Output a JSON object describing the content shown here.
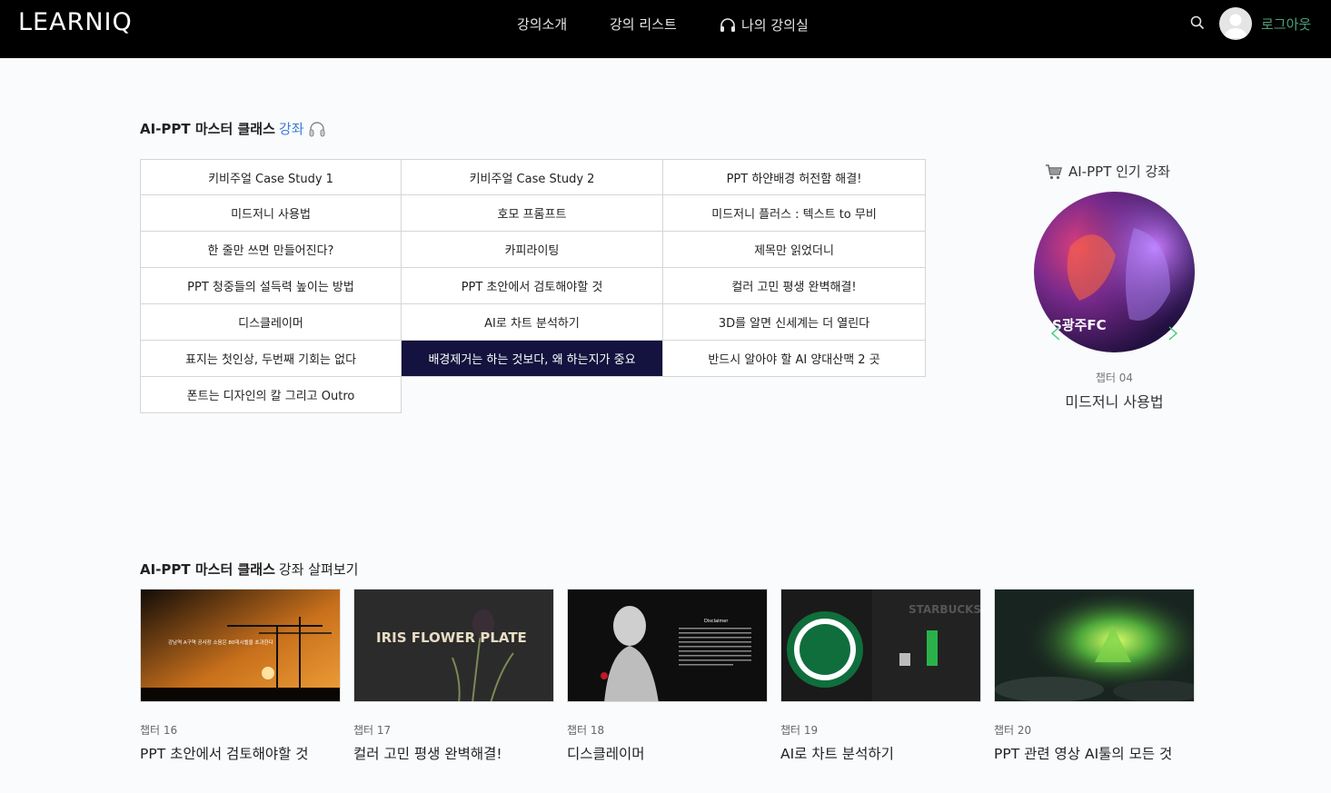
{
  "header": {
    "logo": "LEARNIQ",
    "nav": [
      "강의소개",
      "강의 리스트",
      "나의 강의실"
    ],
    "logout": "로그아웃"
  },
  "course": {
    "title_strong": "AI-PPT 마스터 클래스",
    "title_accent": "강좌",
    "lectures": [
      "키비주얼 Case Study 1",
      "키비주얼 Case Study 2",
      "PPT 하얀배경 허전함 해결!",
      "미드저니 사용법",
      "호모 프롬프트",
      "미드저니 플러스 : 텍스트 to 무비",
      "한 줄만 쓰면 만들어진다?",
      "카피라이팅",
      "제목만 읽었더니",
      "PPT 청중들의 설득력 높이는 방법",
      "PPT 초안에서 검토해야할 것",
      "컬러 고민 평생 완벽해결!",
      "디스클레이머",
      "AI로 차트 분석하기",
      "3D를 알면 신세계는 더 열린다",
      "표지는 첫인상, 두번째 기회는 없다",
      "배경제거는 하는 것보다, 왜 하는지가 중요",
      "반드시 알아야 할 AI 양대산맥 2 곳",
      "폰트는 디자인의 칼 그리고 Outro"
    ],
    "active_lecture": "배경제거는 하는 것보다, 왜 하는지가 중요"
  },
  "popular": {
    "title": "AI-PPT 인기 강좌",
    "image_text": "S광주FC",
    "chapter": "챕터 04",
    "name": "미드저니 사용법"
  },
  "browse": {
    "title_strong": "AI-PPT 마스터 클래스",
    "title_rest": "강좌 살펴보기",
    "cards": [
      {
        "chapter": "챕터 16",
        "title": "PPT 초안에서 검토해야할 것",
        "thumb_text": "강남역 A구역 공사장 소음은 80데시벨을 초과한다"
      },
      {
        "chapter": "챕터 17",
        "title": "컬러 고민 평생 완벽해결!",
        "thumb_text": "IRIS FLOWER PLATE"
      },
      {
        "chapter": "챕터 18",
        "title": "디스클레이머",
        "thumb_text": "Disclaimer"
      },
      {
        "chapter": "챕터 19",
        "title": "AI로 차트 분석하기",
        "thumb_text": "STARBUCKS"
      },
      {
        "chapter": "챕터 20",
        "title": "PPT 관련 영상 AI툴의 모든 것",
        "thumb_text": ""
      }
    ]
  },
  "colors": {
    "header_bg": "#000000",
    "active_cell": "#14123e",
    "accent": "#3a7bd5",
    "logout": "#4fa079"
  }
}
